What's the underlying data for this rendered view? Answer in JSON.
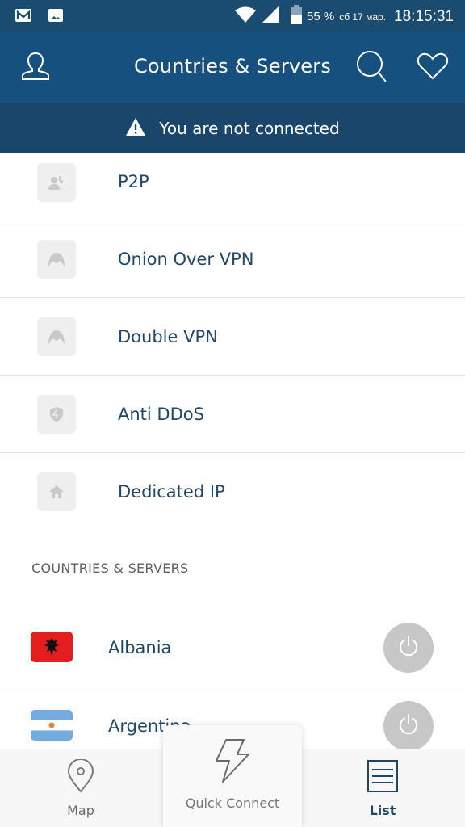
{
  "status_bar": {
    "icons_left": [
      "gmail-icon",
      "gallery-icon"
    ],
    "battery_percent": "55 %",
    "date": "сб 17 мар.",
    "time": "18:15:31"
  },
  "app_bar": {
    "title": "Countries & Servers",
    "profile_icon": "profile-icon",
    "search_icon": "search-icon",
    "favorites_icon": "heart-icon"
  },
  "banner": {
    "message": "You are not connected",
    "icon": "warning-icon"
  },
  "specialty_servers": [
    {
      "label": "P2P",
      "icon": "p2p-icon"
    },
    {
      "label": "Onion Over VPN",
      "icon": "onion-icon"
    },
    {
      "label": "Double VPN",
      "icon": "double-vpn-icon"
    },
    {
      "label": "Anti DDoS",
      "icon": "shield-icon"
    },
    {
      "label": "Dedicated IP",
      "icon": "home-icon"
    }
  ],
  "section_header": "COUNTRIES & SERVERS",
  "countries": [
    {
      "name": "Albania",
      "flag": "albania-flag"
    },
    {
      "name": "Argentina",
      "flag": "argentina-flag"
    }
  ],
  "bottom_nav": {
    "map_label": "Map",
    "quick_connect_label": "Quick Connect",
    "list_label": "List",
    "active": "List"
  },
  "colors": {
    "status_bar": "#1a4b70",
    "app_bar": "#16507e",
    "banner": "#1b466b",
    "text_primary": "#1f4868",
    "albania_red": "#e41e20",
    "argentina_blue": "#74acdf"
  }
}
